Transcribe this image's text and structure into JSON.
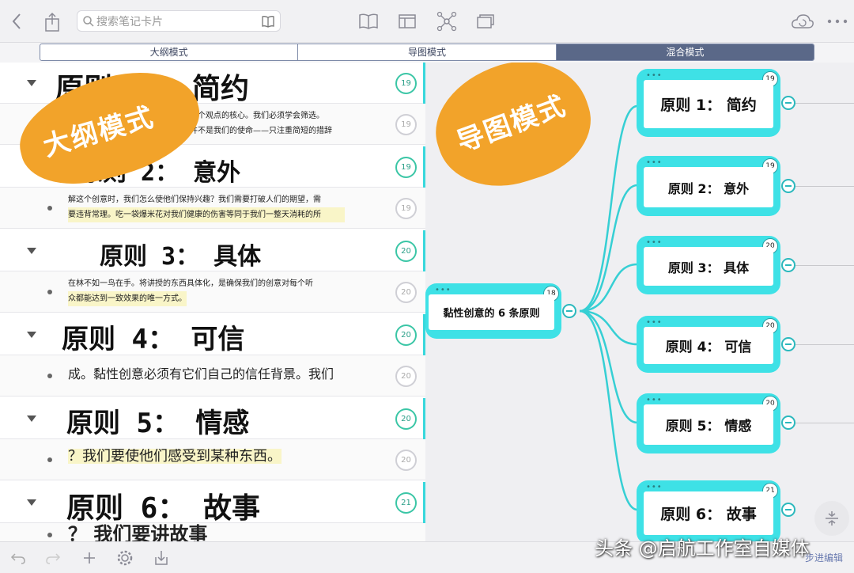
{
  "toolbar": {
    "search_placeholder": "搜索笔记卡片"
  },
  "modes": {
    "outline": "大纲模式",
    "mindmap": "导图模式",
    "mixed": "混合模式",
    "active": "mixed"
  },
  "blobs": {
    "outline_label": "大纲模式",
    "mindmap_label": "导图模式"
  },
  "outline": {
    "rows": [
      {
        "type": "heading",
        "text": "原则 1： 简约",
        "count": "19"
      },
      {
        "type": "body",
        "line1": "往一个观点的核心。我们必须学会筛选。",
        "line2": "短并不是我们的使命——只注重简短的措辞",
        "count": "19"
      },
      {
        "type": "heading",
        "text": "原则 2： 意外",
        "count": "19"
      },
      {
        "type": "body",
        "line1": "解这个创意时，我们怎么使他们保持兴趣？我们需要打破人们的期望，需",
        "line2": "要违背常理。吃一袋爆米花对我们健康的伤害等同于我们一整天消耗的所",
        "count": "19"
      },
      {
        "type": "heading",
        "text": "原则 3： 具体",
        "count": "20"
      },
      {
        "type": "body",
        "line1": "在林不如一鸟在手。将讲授的东西具体化，是确保我们的创意对每个听",
        "line2": "众都能达到一致效果的唯一方式。",
        "count": "20"
      },
      {
        "type": "heading",
        "text": "原则 4： 可信",
        "count": "20"
      },
      {
        "type": "body",
        "line1": "成。黏性创意必须有它们自己的信任背景。我们",
        "line2": "",
        "count": "20"
      },
      {
        "type": "heading",
        "text": "原则 5： 情感",
        "count": "20"
      },
      {
        "type": "body",
        "line1": "？我们要使他们感受到某种东西。",
        "line2": "",
        "count": "20"
      },
      {
        "type": "heading",
        "text": "原则 6： 故事",
        "count": "21"
      },
      {
        "type": "body",
        "line1": "？ 我们要讲故事",
        "line2": "",
        "count": ""
      }
    ]
  },
  "mindmap": {
    "root": {
      "label": "黏性创意的 6 条原则",
      "count": "18"
    },
    "children": [
      {
        "label": "原则 1： 简约",
        "count": "19"
      },
      {
        "label": "原则 2： 意外",
        "count": "19"
      },
      {
        "label": "原则 3： 具体",
        "count": "20"
      },
      {
        "label": "原则 4： 可信",
        "count": "20"
      },
      {
        "label": "原则 5： 情感",
        "count": "20"
      },
      {
        "label": "原则 6： 故事",
        "count": "21"
      }
    ]
  },
  "watermark": "头条 @启航工作室自媒体",
  "bottom_right_label": "步进编辑",
  "colors": {
    "accent_cyan": "#3ee1e6",
    "badge_green": "#3bc6a6",
    "blob_orange": "#f2a32a",
    "segment_active": "#5a6888"
  }
}
